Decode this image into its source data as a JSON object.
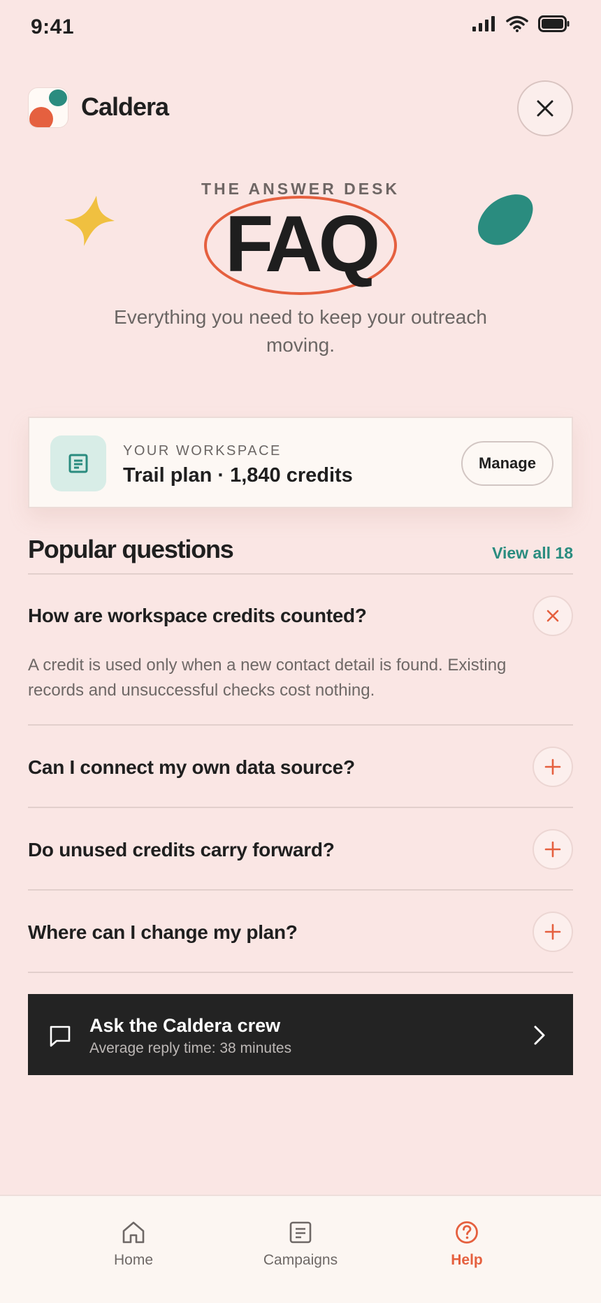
{
  "status_bar": {
    "time": "9:41"
  },
  "header": {
    "brand": "Caldera"
  },
  "hero": {
    "kicker": "THE ANSWER DESK",
    "title": "FAQ",
    "subtitle": "Everything you need to keep your outreach moving."
  },
  "workspace": {
    "label": "YOUR WORKSPACE",
    "value": "Trail plan · 1,840 credits",
    "manage_label": "Manage"
  },
  "popular": {
    "title": "Popular questions",
    "view_all": "View all 18",
    "questions": [
      {
        "question": "How are workspace credits counted?",
        "expanded": true,
        "answer": "A credit is used only when a new contact detail is found. Existing records and unsuccessful checks cost nothing."
      },
      {
        "question": "Can I connect my own data source?",
        "expanded": false
      },
      {
        "question": "Do unused credits carry forward?",
        "expanded": false
      },
      {
        "question": "Where can I change my plan?",
        "expanded": false
      }
    ]
  },
  "crew": {
    "title": "Ask the Caldera crew",
    "subtitle": "Average reply time: 38 minutes"
  },
  "tabbar": {
    "items": [
      {
        "label": "Home",
        "icon": "home-icon",
        "active": false
      },
      {
        "label": "Campaigns",
        "icon": "campaigns-icon",
        "active": false
      },
      {
        "label": "Help",
        "icon": "help-icon",
        "active": true
      }
    ]
  },
  "colors": {
    "background": "#fae6e4",
    "accent": "#e5603f",
    "teal": "#2a8c7f",
    "star": "#f0c040",
    "dark": "#232323"
  }
}
